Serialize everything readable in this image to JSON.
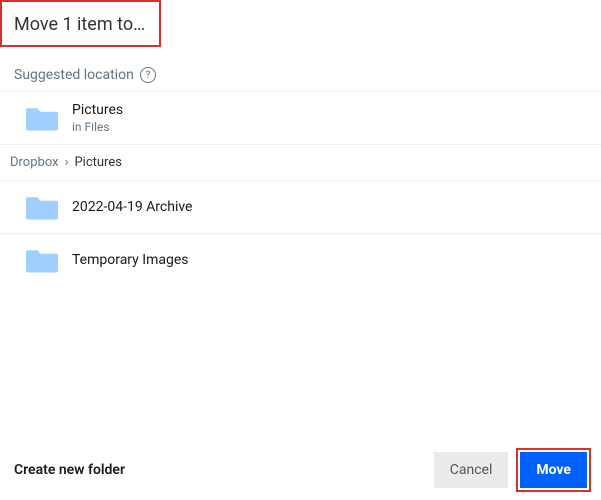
{
  "dialog": {
    "title": "Move 1 item to…"
  },
  "suggested": {
    "label": "Suggested location",
    "name": "Pictures",
    "sub": "in Files"
  },
  "breadcrumb": {
    "root": "Dropbox",
    "current": "Pictures"
  },
  "folders": [
    {
      "name": "2022-04-19 Archive"
    },
    {
      "name": "Temporary Images"
    }
  ],
  "footer": {
    "create": "Create new folder",
    "cancel": "Cancel",
    "move": "Move"
  }
}
